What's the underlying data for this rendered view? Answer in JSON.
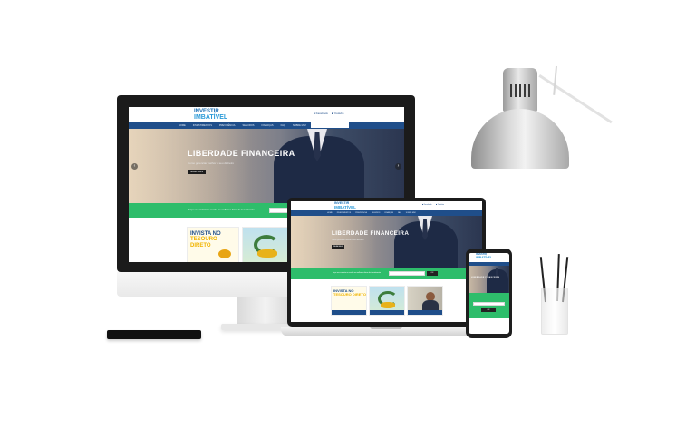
{
  "site": {
    "logo_line1": "INVESTIR",
    "logo_line2": "IMBATÍVEL",
    "nav_items": [
      "HOME",
      "INVESTIMENTOS",
      "PREVIDÊNCIA",
      "SEGUROS",
      "FINANÇAS",
      "FAQ",
      "SOBRE MIM"
    ],
    "top_links": [
      "Facebook",
      "Youtube"
    ],
    "hero_headline": "LIBERDADE FINANCEIRA",
    "hero_sub": "Como gerenciar melhor o seu dinheiro",
    "hero_cta": "SAIBA MAIS",
    "band_text": "Faça seu cadastro e receba as melhores dicas de investimento",
    "band_button": "OK",
    "card1_title_a": "INVISTA NO",
    "card1_title_b": "TESOURO DIRETO"
  },
  "colors": {
    "nav": "#1f4e8a",
    "band": "#2ebd6b",
    "accent": "#f0b400"
  }
}
